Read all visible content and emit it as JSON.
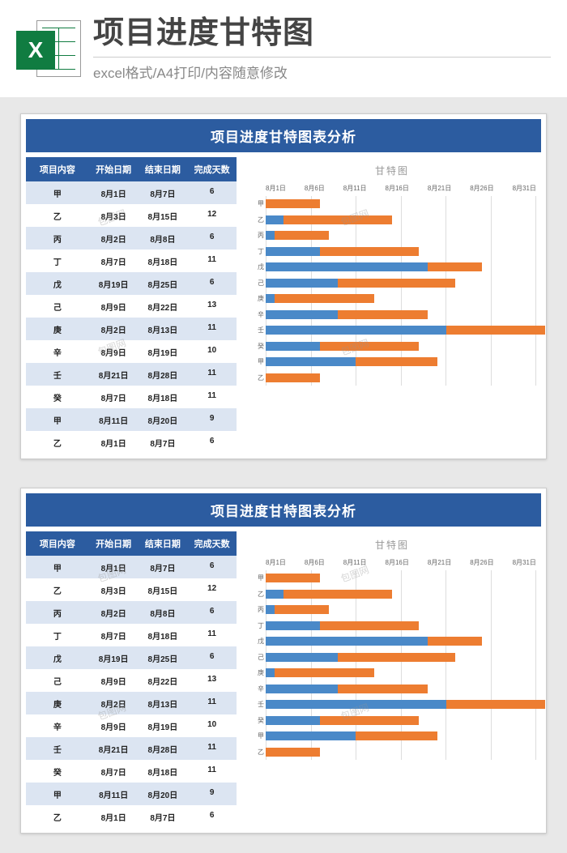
{
  "header": {
    "excel_badge": "X",
    "main_title": "项目进度甘特图",
    "sub_title": "excel格式/A4打印/内容随意修改"
  },
  "panel": {
    "title": "项目进度甘特图表分析",
    "columns": [
      "项目内容",
      "开始日期",
      "结束日期",
      "完成天数"
    ],
    "rows": [
      {
        "name": "甲",
        "start": "8月1日",
        "end": "8月7日",
        "days": 6,
        "start_day": 1
      },
      {
        "name": "乙",
        "start": "8月3日",
        "end": "8月15日",
        "days": 12,
        "start_day": 3
      },
      {
        "name": "丙",
        "start": "8月2日",
        "end": "8月8日",
        "days": 6,
        "start_day": 2
      },
      {
        "name": "丁",
        "start": "8月7日",
        "end": "8月18日",
        "days": 11,
        "start_day": 7
      },
      {
        "name": "戊",
        "start": "8月19日",
        "end": "8月25日",
        "days": 6,
        "start_day": 19
      },
      {
        "name": "己",
        "start": "8月9日",
        "end": "8月22日",
        "days": 13,
        "start_day": 9
      },
      {
        "name": "庚",
        "start": "8月2日",
        "end": "8月13日",
        "days": 11,
        "start_day": 2
      },
      {
        "name": "辛",
        "start": "8月9日",
        "end": "8月19日",
        "days": 10,
        "start_day": 9
      },
      {
        "name": "壬",
        "start": "8月21日",
        "end": "8月28日",
        "days": 11,
        "start_day": 21
      },
      {
        "name": "癸",
        "start": "8月7日",
        "end": "8月18日",
        "days": 11,
        "start_day": 7
      },
      {
        "name": "甲",
        "start": "8月11日",
        "end": "8月20日",
        "days": 9,
        "start_day": 11
      },
      {
        "name": "乙",
        "start": "8月1日",
        "end": "8月7日",
        "days": 6,
        "start_day": 1
      }
    ]
  },
  "chart_data": {
    "type": "bar",
    "title": "甘特图",
    "x_ticks": [
      "8月1日",
      "8月6日",
      "8月11日",
      "8月16日",
      "8月21日",
      "8月26日",
      "8月31日"
    ],
    "x_min": 1,
    "x_max": 31,
    "categories": [
      "甲",
      "乙",
      "丙",
      "丁",
      "戊",
      "己",
      "庚",
      "辛",
      "壬",
      "癸",
      "甲",
      "乙"
    ],
    "series": [
      {
        "name": "offset_days_from_aug1",
        "values": [
          0,
          2,
          1,
          6,
          18,
          8,
          1,
          8,
          20,
          6,
          10,
          0
        ]
      },
      {
        "name": "duration_days",
        "values": [
          6,
          12,
          6,
          11,
          6,
          13,
          11,
          10,
          11,
          11,
          9,
          6
        ]
      }
    ],
    "colors": {
      "offset": "#4a89c8",
      "duration": "#ed7d31"
    }
  },
  "watermark_text": "包图网"
}
